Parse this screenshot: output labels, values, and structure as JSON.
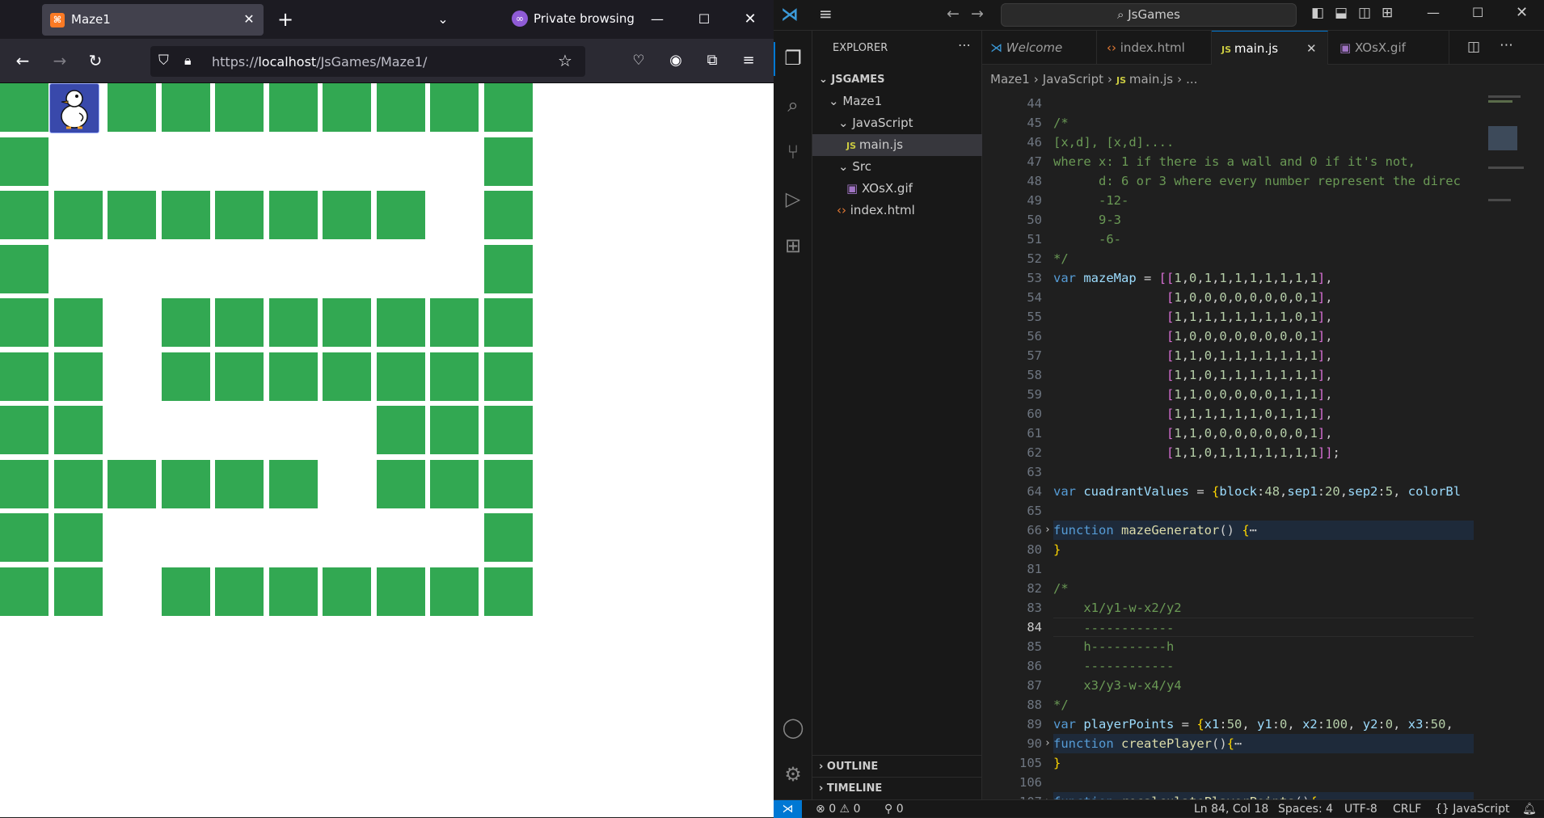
{
  "browser": {
    "tab_title": "Maze1",
    "private_label": "Private browsing",
    "url_prefix": "https://",
    "url_host": "localhost",
    "url_path": "/JsGames/Maze1/"
  },
  "maze": {
    "map": [
      [
        1,
        0,
        1,
        1,
        1,
        1,
        1,
        1,
        1,
        1
      ],
      [
        1,
        0,
        0,
        0,
        0,
        0,
        0,
        0,
        0,
        1
      ],
      [
        1,
        1,
        1,
        1,
        1,
        1,
        1,
        1,
        0,
        1
      ],
      [
        1,
        0,
        0,
        0,
        0,
        0,
        0,
        0,
        0,
        1
      ],
      [
        1,
        1,
        0,
        1,
        1,
        1,
        1,
        1,
        1,
        1
      ],
      [
        1,
        1,
        0,
        1,
        1,
        1,
        1,
        1,
        1,
        1
      ],
      [
        1,
        1,
        0,
        0,
        0,
        0,
        0,
        1,
        1,
        1
      ],
      [
        1,
        1,
        1,
        1,
        1,
        1,
        0,
        1,
        1,
        1
      ],
      [
        1,
        1,
        0,
        0,
        0,
        0,
        0,
        0,
        0,
        1
      ],
      [
        1,
        1,
        0,
        1,
        1,
        1,
        1,
        1,
        1,
        1
      ]
    ],
    "wall_color": "#32a852",
    "player_icon": "duck-player-icon"
  },
  "vscode": {
    "search_text": "JsGames",
    "explorer_title": "EXPLORER",
    "tree": {
      "root": "JSGAMES",
      "folder": "Maze1",
      "js_folder": "JavaScript",
      "js_file": "main.js",
      "src_folder": "Src",
      "gif_file": "XOsX.gif",
      "html_file": "index.html"
    },
    "outline": "OUTLINE",
    "timeline": "TIMELINE",
    "tabs": [
      "Welcome",
      "index.html",
      "main.js",
      "XOsX.gif"
    ],
    "breadcrumb": [
      "Maze1",
      "JavaScript",
      "main.js",
      "..."
    ],
    "code_lines": [
      {
        "n": "44",
        "t": ""
      },
      {
        "n": "45",
        "t": "/*"
      },
      {
        "n": "46",
        "t": "[x,d], [x,d]...."
      },
      {
        "n": "47",
        "t": "where x: 1 if there is a wall and 0 if it's not,"
      },
      {
        "n": "48",
        "t": "      d: 6 or 3 where every number represent the direc"
      },
      {
        "n": "49",
        "t": "      -12-"
      },
      {
        "n": "50",
        "t": "      9-3"
      },
      {
        "n": "51",
        "t": "      -6-"
      },
      {
        "n": "52",
        "t": "*/"
      },
      {
        "n": "53",
        "t": "var mazeMap = [[1,0,1,1,1,1,1,1,1,1],"
      },
      {
        "n": "54",
        "t": "               [1,0,0,0,0,0,0,0,0,1],"
      },
      {
        "n": "55",
        "t": "               [1,1,1,1,1,1,1,1,0,1],"
      },
      {
        "n": "56",
        "t": "               [1,0,0,0,0,0,0,0,0,1],"
      },
      {
        "n": "57",
        "t": "               [1,1,0,1,1,1,1,1,1,1],"
      },
      {
        "n": "58",
        "t": "               [1,1,0,1,1,1,1,1,1,1],"
      },
      {
        "n": "59",
        "t": "               [1,1,0,0,0,0,0,1,1,1],"
      },
      {
        "n": "60",
        "t": "               [1,1,1,1,1,1,0,1,1,1],"
      },
      {
        "n": "61",
        "t": "               [1,1,0,0,0,0,0,0,0,1],"
      },
      {
        "n": "62",
        "t": "               [1,1,0,1,1,1,1,1,1,1]];"
      },
      {
        "n": "63",
        "t": ""
      },
      {
        "n": "64",
        "t": "var cuadrantValues = {block:48,sep1:20,sep2:5, colorBl"
      },
      {
        "n": "65",
        "t": ""
      },
      {
        "n": "66",
        "t": "function mazeGenerator() {⋯"
      },
      {
        "n": "80",
        "t": "}"
      },
      {
        "n": "81",
        "t": ""
      },
      {
        "n": "82",
        "t": "/*"
      },
      {
        "n": "83",
        "t": "    x1/y1-w-x2/y2"
      },
      {
        "n": "84",
        "t": "    ------------"
      },
      {
        "n": "85",
        "t": "    h----------h"
      },
      {
        "n": "86",
        "t": "    ------------"
      },
      {
        "n": "87",
        "t": "    x3/y3-w-x4/y4"
      },
      {
        "n": "88",
        "t": "*/"
      },
      {
        "n": "89",
        "t": "var playerPoints = {x1:50, y1:0, x2:100, y2:0, x3:50, "
      },
      {
        "n": "90",
        "t": "function createPlayer(){⋯"
      },
      {
        "n": "105",
        "t": "}"
      },
      {
        "n": "106",
        "t": ""
      },
      {
        "n": "107",
        "t": "function recalculatePlayerPoints(){⋯"
      }
    ],
    "status": {
      "errors": "0",
      "warnings": "0",
      "ports": "0",
      "position": "Ln 84, Col 18",
      "spaces": "Spaces: 4",
      "encoding": "UTF-8",
      "eol": "CRLF",
      "language": "{} JavaScript"
    }
  }
}
